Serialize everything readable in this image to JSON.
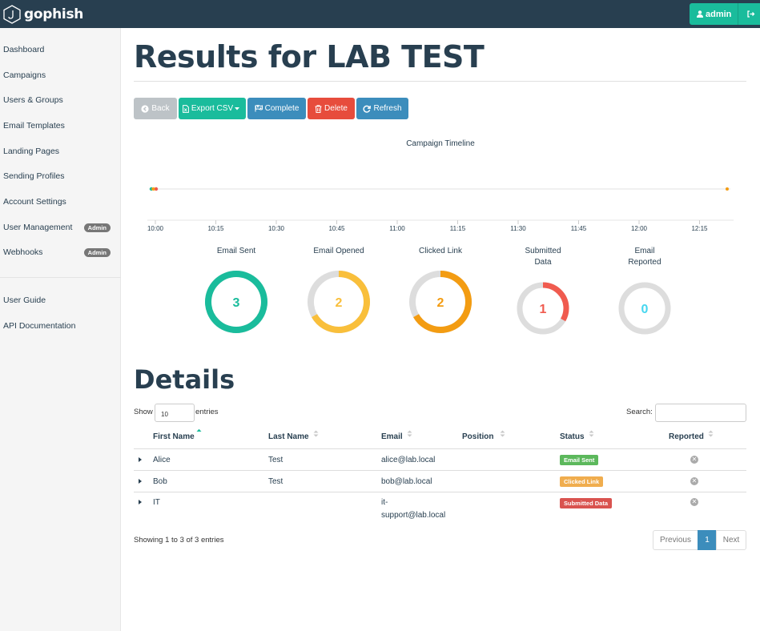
{
  "app": {
    "name": "gophish",
    "user": "admin"
  },
  "colors": {
    "navbar": "#283f50",
    "sidebar": "#f5f5f5",
    "accent": "#1abc9c",
    "sent": "#1abc9c",
    "opened": "#f9bf3b",
    "clicked": "#f39c12",
    "submitted": "#f05b4f",
    "reported": "#45d6ef",
    "ring_bg": "#dddddd"
  },
  "sidebar": {
    "items": [
      {
        "label": "Dashboard"
      },
      {
        "label": "Campaigns"
      },
      {
        "label": "Users & Groups"
      },
      {
        "label": "Email Templates"
      },
      {
        "label": "Landing Pages"
      },
      {
        "label": "Sending Profiles"
      },
      {
        "label": "Account Settings"
      },
      {
        "label": "User Management",
        "badge": "Admin"
      },
      {
        "label": "Webhooks",
        "badge": "Admin"
      }
    ],
    "secondary": [
      {
        "label": "User Guide"
      },
      {
        "label": "API Documentation"
      }
    ]
  },
  "page": {
    "title": "Results for LAB TEST"
  },
  "toolbar": {
    "back": "Back",
    "export": "Export CSV",
    "complete": "Complete",
    "delete": "Delete",
    "refresh": "Refresh"
  },
  "timeline": {
    "title": "Campaign Timeline",
    "ticks": [
      "10:00",
      "10:15",
      "10:30",
      "10:45",
      "11:00",
      "11:15",
      "11:30",
      "11:45",
      "12:00",
      "12:15"
    ]
  },
  "stats": [
    {
      "label": "Email Sent",
      "value": "3",
      "fraction": 1.0,
      "color": "#1abc9c"
    },
    {
      "label": "Email Opened",
      "value": "2",
      "fraction": 0.667,
      "color": "#f9bf3b"
    },
    {
      "label": "Clicked Link",
      "value": "2",
      "fraction": 0.667,
      "color": "#f39c12"
    },
    {
      "label": "Submitted Data",
      "label_lines": [
        "Submitted",
        "Data"
      ],
      "value": "1",
      "fraction": 0.333,
      "color": "#f05b4f"
    },
    {
      "label": "Email Reported",
      "label_lines": [
        "Email",
        "Reported"
      ],
      "value": "0",
      "fraction": 0.0,
      "color": "#45d6ef"
    }
  ],
  "details": {
    "title": "Details",
    "show": "Show",
    "entries_value": "10",
    "entries": "entries",
    "search": "Search:",
    "columns": [
      "First Name",
      "Last Name",
      "Email",
      "Position",
      "Status",
      "Reported"
    ],
    "rows": [
      {
        "first": "Alice",
        "last": "Test",
        "email": "alice@lab.local",
        "position": "",
        "status": "Email Sent",
        "status_color": "#5cb85c"
      },
      {
        "first": "Bob",
        "last": "Test",
        "email": "bob@lab.local",
        "position": "",
        "status": "Clicked Link",
        "status_color": "#f0ad4e"
      },
      {
        "first": "IT",
        "last": "",
        "email_lines": [
          "it-",
          "support@lab.local"
        ],
        "position": "",
        "status": "Submitted Data",
        "status_color": "#d9534f"
      }
    ],
    "showing": "Showing 1 to 3 of 3 entries",
    "pager": {
      "previous": "Previous",
      "page": "1",
      "next": "Next"
    }
  }
}
